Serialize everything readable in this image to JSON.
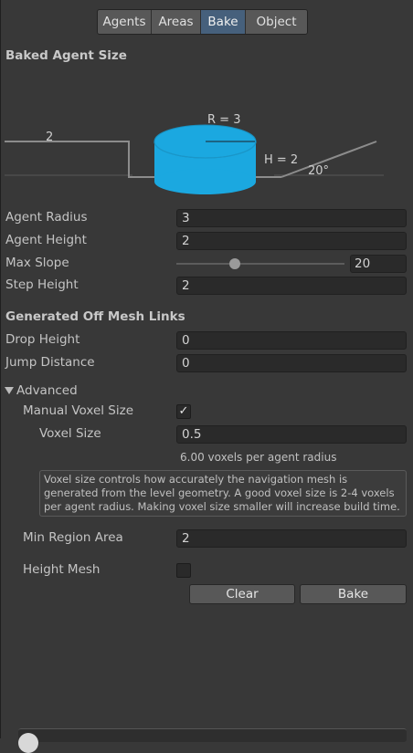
{
  "tabs": [
    "Agents",
    "Areas",
    "Bake",
    "Object"
  ],
  "active_tab": "Bake",
  "baked_agent_size": {
    "title": "Baked Agent Size",
    "step_label": "2",
    "radius_label": "R = 3",
    "height_label": "H = 2",
    "slope_label": "20°",
    "cylinder_color": "#1ba8e0"
  },
  "agent": {
    "radius_label": "Agent Radius",
    "radius_value": "3",
    "height_label": "Agent Height",
    "height_value": "2",
    "max_slope_label": "Max Slope",
    "max_slope_value": "20",
    "max_slope_fraction": 0.35,
    "step_height_label": "Step Height",
    "step_height_value": "2"
  },
  "offmesh": {
    "title": "Generated Off Mesh Links",
    "drop_label": "Drop Height",
    "drop_value": "0",
    "jump_label": "Jump Distance",
    "jump_value": "0"
  },
  "advanced": {
    "title": "Advanced",
    "manual_voxel_label": "Manual Voxel Size",
    "manual_voxel_checked": "✓",
    "voxel_size_label": "Voxel Size",
    "voxel_size_value": "0.5",
    "voxels_info": "6.00 voxels per agent radius",
    "help_text": "Voxel size controls how accurately the navigation mesh is generated from the level geometry. A good voxel size is 2-4 voxels per agent radius. Making voxel size smaller will increase build time.",
    "min_region_label": "Min Region Area",
    "min_region_value": "2",
    "height_mesh_label": "Height Mesh",
    "height_mesh_checked": ""
  },
  "buttons": {
    "clear": "Clear",
    "bake": "Bake"
  }
}
